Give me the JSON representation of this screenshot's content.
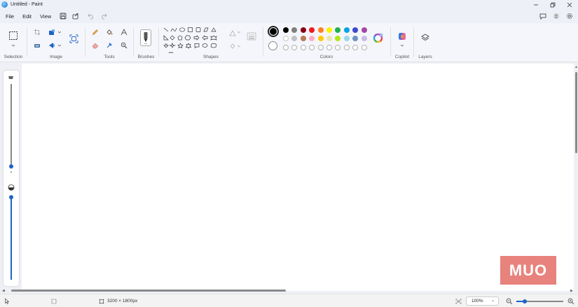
{
  "window": {
    "title": "Untitled - Paint"
  },
  "menu": {
    "file": "File",
    "edit": "Edit",
    "view": "View"
  },
  "ribbon": {
    "selection_label": "Selection",
    "image_label": "Image",
    "tools_label": "Tools",
    "brushes_label": "Brushes",
    "shapes_label": "Shapes",
    "colors_label": "Colors",
    "copilot_label": "Copilot",
    "layers_label": "Layers"
  },
  "colors": {
    "primary": "#000000",
    "row1": [
      "#000000",
      "#7f7f7f",
      "#880015",
      "#ed1c24",
      "#ff7f27",
      "#fff200",
      "#22b14c",
      "#00a2e8",
      "#3f48cc",
      "#a349a4"
    ],
    "row2": [
      "#ffffff",
      "#c3c3c3",
      "#b97a57",
      "#ffaec9",
      "#ffc90e",
      "#efe4b0",
      "#b5e61d",
      "#99d9ea",
      "#7092be",
      "#c8bfe7"
    ]
  },
  "watermark": {
    "text": "MUO"
  },
  "status": {
    "canvas_size": "3200 × 1800px",
    "zoom": "100%"
  }
}
